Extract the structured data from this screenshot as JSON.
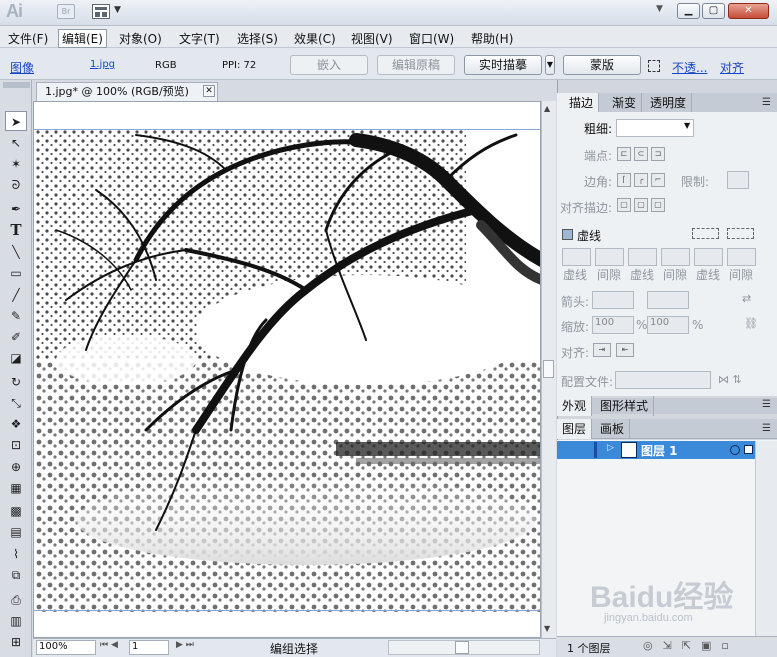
{
  "app": {
    "logo": "Ai",
    "bridge_label": "Br",
    "window_minimize": "▁",
    "window_restore": "▢",
    "window_close": "✕",
    "dropdown_arrow": "▼"
  },
  "menu": [
    "文件(F)",
    "编辑(E)",
    "对象(O)",
    "文字(T)",
    "选择(S)",
    "效果(C)",
    "视图(V)",
    "窗口(W)",
    "帮助(H)"
  ],
  "control": {
    "image_link": "图像",
    "filename": "1.jpg",
    "mode": "RGB",
    "ppi": "PPI: 72",
    "embed": "嵌入",
    "edit_original": "编辑原稿",
    "live_trace": "实时描摹",
    "mask": "蒙版",
    "opacity": "不透...",
    "align": "对齐"
  },
  "document": {
    "tab_title": "1.jpg* @ 100% (RGB/预览)",
    "close": "✕"
  },
  "status": {
    "zoom": "100%",
    "page": "1",
    "selection": "编组选择"
  },
  "stroke_panel": {
    "tabs": [
      "描边",
      "渐变",
      "透明度"
    ],
    "weight_label": "粗细:",
    "cap_label": "端点:",
    "corner_label": "边角:",
    "limit_label": "限制:",
    "align_label": "对齐描边:",
    "dashed_label": "虚线",
    "dash_labels": [
      "虚线",
      "间隙",
      "虚线",
      "间隙",
      "虚线",
      "间隙"
    ],
    "arrow_label": "箭头:",
    "scale_label": "缩放:",
    "scale_start": "100",
    "scale_end": "100",
    "percent": "%",
    "align_arrows_label": "对齐:",
    "profile_label": "配置文件:"
  },
  "appearance_tabs": [
    "外观",
    "图形样式"
  ],
  "layers_tabs": [
    "图层",
    "画板"
  ],
  "layer": {
    "name": "图层 1",
    "count": "1 个图层"
  },
  "watermark": {
    "logo": "Baidu经验",
    "url": "jingyan.baidu.com"
  },
  "colors": {
    "layer_highlight": "#3b8ad9",
    "link": "#1745c7"
  }
}
